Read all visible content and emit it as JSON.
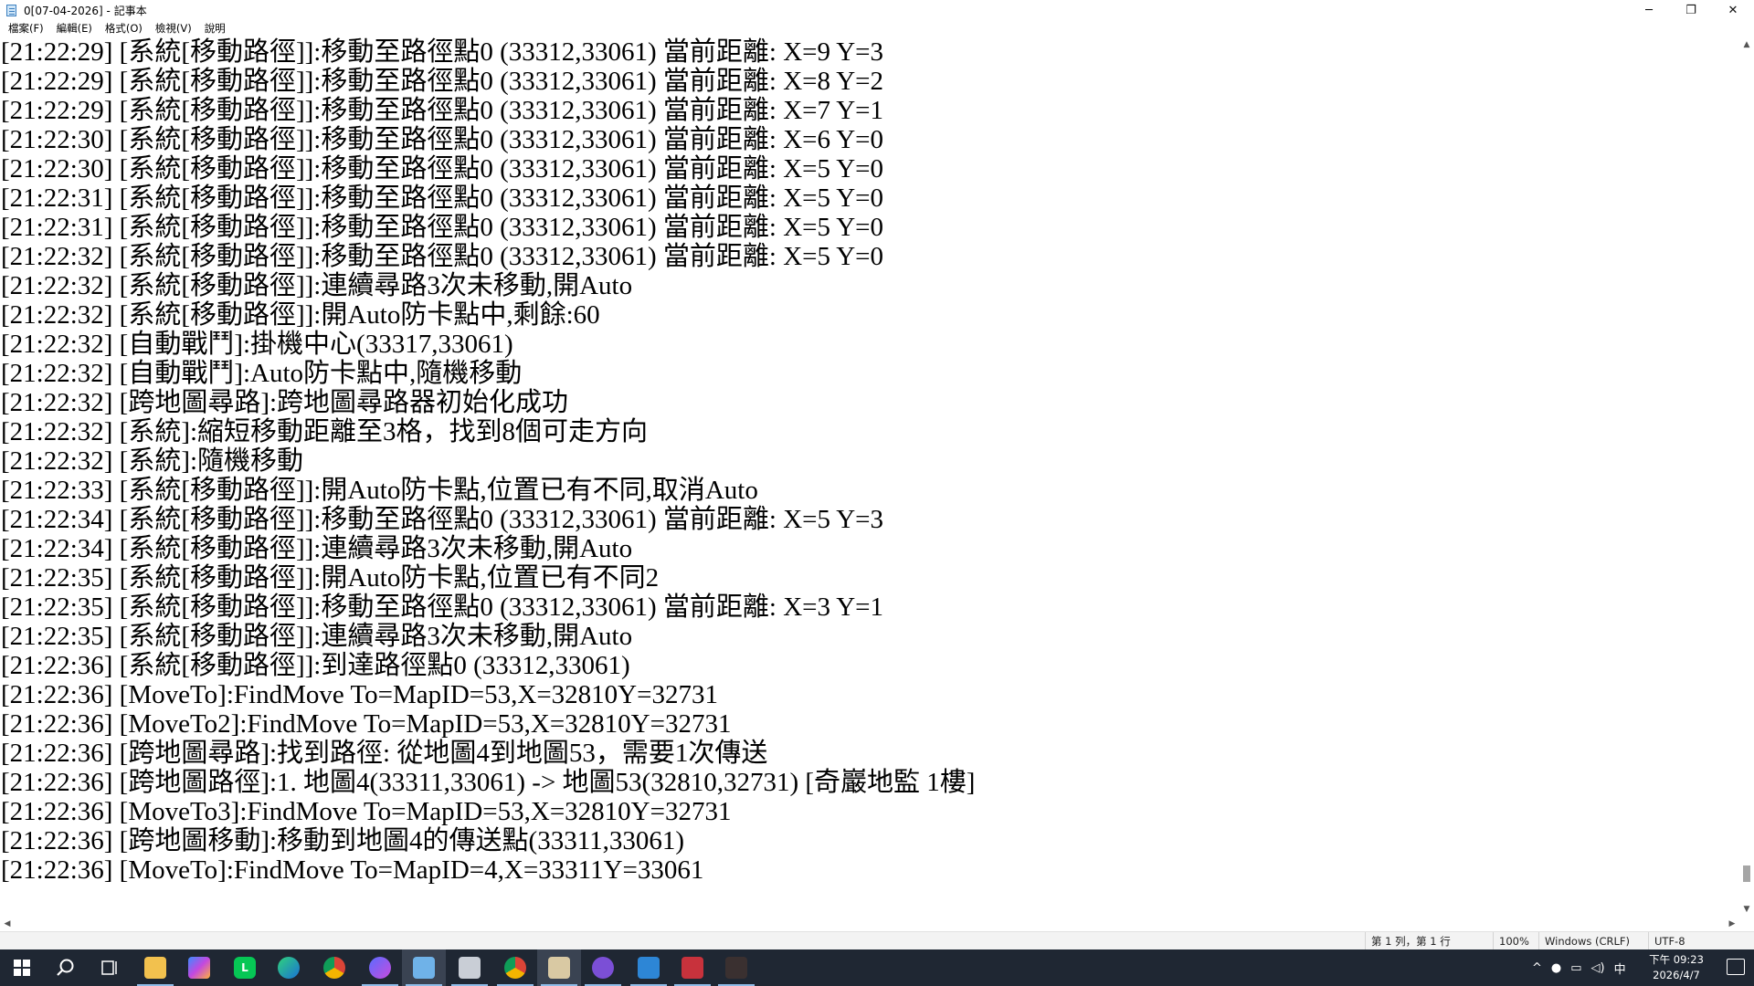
{
  "window": {
    "title": "0[07-04-2026] - 記事本",
    "minimize_glyph": "─",
    "maximize_glyph": "❐",
    "close_glyph": "✕"
  },
  "menu": [
    "檔案(F)",
    "編輯(E)",
    "格式(O)",
    "檢視(V)",
    "說明"
  ],
  "log_lines": [
    "[21:22:29] [系統[移動路徑]]:移動至路徑點0 (33312,33061) 當前距離: X=9 Y=3",
    "[21:22:29] [系統[移動路徑]]:移動至路徑點0 (33312,33061) 當前距離: X=8 Y=2",
    "[21:22:29] [系統[移動路徑]]:移動至路徑點0 (33312,33061) 當前距離: X=7 Y=1",
    "[21:22:30] [系統[移動路徑]]:移動至路徑點0 (33312,33061) 當前距離: X=6 Y=0",
    "[21:22:30] [系統[移動路徑]]:移動至路徑點0 (33312,33061) 當前距離: X=5 Y=0",
    "[21:22:31] [系統[移動路徑]]:移動至路徑點0 (33312,33061) 當前距離: X=5 Y=0",
    "[21:22:31] [系統[移動路徑]]:移動至路徑點0 (33312,33061) 當前距離: X=5 Y=0",
    "[21:22:32] [系統[移動路徑]]:移動至路徑點0 (33312,33061) 當前距離: X=5 Y=0",
    "[21:22:32] [系統[移動路徑]]:連續尋路3次未移動,開Auto",
    "[21:22:32] [系統[移動路徑]]:開Auto防卡點中,剩餘:60",
    "[21:22:32] [自動戰鬥]:掛機中心(33317,33061)",
    "[21:22:32] [自動戰鬥]:Auto防卡點中,隨機移動",
    "[21:22:32] [跨地圖尋路]:跨地圖尋路器初始化成功",
    "[21:22:32] [系統]:縮短移動距離至3格，找到8個可走方向",
    "[21:22:32] [系統]:隨機移動",
    "[21:22:33] [系統[移動路徑]]:開Auto防卡點,位置已有不同,取消Auto",
    "[21:22:34] [系統[移動路徑]]:移動至路徑點0 (33312,33061) 當前距離: X=5 Y=3",
    "[21:22:34] [系統[移動路徑]]:連續尋路3次未移動,開Auto",
    "[21:22:35] [系統[移動路徑]]:開Auto防卡點,位置已有不同2",
    "[21:22:35] [系統[移動路徑]]:移動至路徑點0 (33312,33061) 當前距離: X=3 Y=1",
    "[21:22:35] [系統[移動路徑]]:連續尋路3次未移動,開Auto",
    "[21:22:36] [系統[移動路徑]]:到達路徑點0 (33312,33061)",
    "[21:22:36] [MoveTo]:FindMove To=MapID=53,X=32810Y=32731",
    "[21:22:36] [MoveTo2]:FindMove To=MapID=53,X=32810Y=32731",
    "[21:22:36] [跨地圖尋路]:找到路徑: 從地圖4到地圖53，需要1次傳送",
    "[21:22:36] [跨地圖路徑]:1. 地圖4(33311,33061) -> 地圖53(32810,32731) [奇巖地監 1樓]",
    "[21:22:36] [MoveTo3]:FindMove To=MapID=53,X=32810Y=32731",
    "[21:22:36] [跨地圖移動]:移動到地圖4的傳送點(33311,33061)",
    "[21:22:36] [MoveTo]:FindMove To=MapID=4,X=33311Y=33061"
  ],
  "status": {
    "position": "第 1 列，第 1 行",
    "zoom": "100%",
    "line_ending": "Windows (CRLF)",
    "encoding": "UTF-8"
  },
  "taskbar": {
    "apps": [
      "start-icon",
      "search-icon",
      "task-view-icon",
      "file-explorer-icon",
      "copilot-icon",
      "line-icon",
      "edge-icon",
      "chrome-icon",
      "messenger-icon",
      "notepad-icon",
      "app-window-icon",
      "chrome-profile-icon",
      "game-client-icon",
      "discord-icon",
      "settings-bot-icon",
      "red-app-icon",
      "dark-app-icon"
    ],
    "tray_ime": "中",
    "clock_time": "下午 09:23",
    "clock_date": "2026/4/7"
  }
}
